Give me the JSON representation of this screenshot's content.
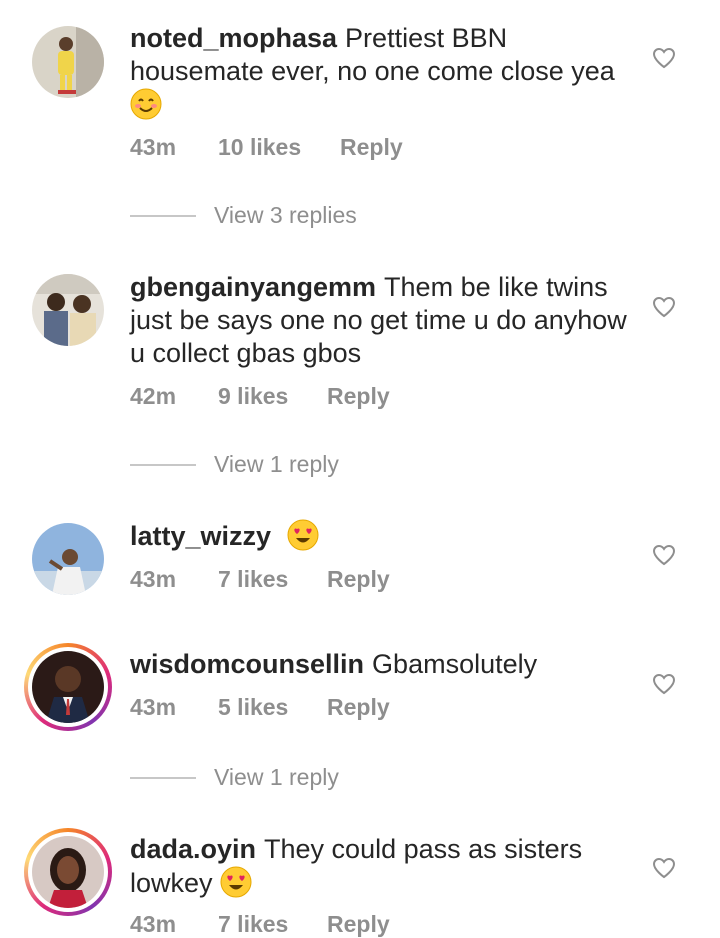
{
  "comments": [
    {
      "username": "noted_mophasa",
      "text": "Prettiest BBN housemate ever, no one come close yea",
      "emoji": "smiling-face-emoji",
      "time": "43m",
      "likes": "10 likes",
      "reply": "Reply",
      "view_replies": "View 3 replies"
    },
    {
      "username": "gbengainyangemm",
      "text": "Them be like twins just be says one no get time u do anyhow u collect gbas gbos",
      "time": "42m",
      "likes": "9 likes",
      "reply": "Reply",
      "view_replies": "View 1 reply"
    },
    {
      "username": "latty_wizzy",
      "text": "",
      "emoji": "heart-eyes-emoji",
      "time": "43m",
      "likes": "7 likes",
      "reply": "Reply"
    },
    {
      "username": "wisdomcounsellin",
      "text": "Gbamsolutely",
      "time": "43m",
      "likes": "5 likes",
      "reply": "Reply",
      "view_replies": "View 1 reply"
    },
    {
      "username": "dada.oyin",
      "text": "They could pass as sisters lowkey",
      "emoji": "heart-eyes-emoji",
      "time": "43m",
      "likes": "7 likes",
      "reply": "Reply"
    }
  ],
  "colors": {
    "text": "#262626",
    "meta": "#8e8e8e",
    "story_ring": "#dd2a7b"
  }
}
